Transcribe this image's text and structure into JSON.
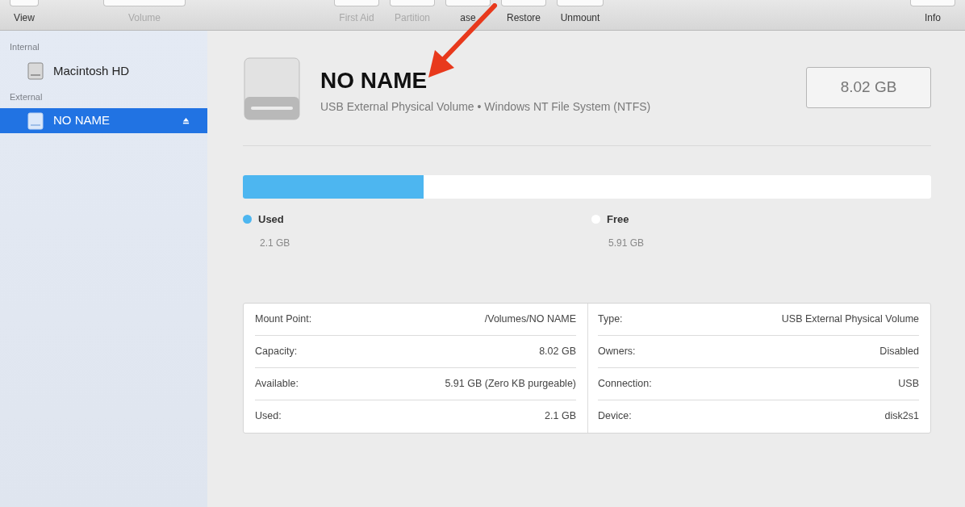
{
  "toolbar": {
    "left": [
      {
        "label": "View",
        "disabled": false
      },
      {
        "label": "Volume",
        "disabled": true
      }
    ],
    "center": [
      {
        "label": "First Aid",
        "disabled": true
      },
      {
        "label": "Partition",
        "disabled": true
      },
      {
        "label": "ase",
        "disabled": false
      },
      {
        "label": "Restore",
        "disabled": false
      },
      {
        "label": "Unmount",
        "disabled": false
      }
    ],
    "right": [
      {
        "label": "Info",
        "disabled": false
      }
    ]
  },
  "sidebar": {
    "sections": [
      {
        "title": "Internal",
        "items": [
          {
            "label": "Macintosh HD",
            "selected": false,
            "eject": false
          }
        ]
      },
      {
        "title": "External",
        "items": [
          {
            "label": "NO NAME",
            "selected": true,
            "eject": true
          }
        ]
      }
    ]
  },
  "volume": {
    "name": "NO NAME",
    "description": "USB External Physical Volume • Windows NT File System (NTFS)",
    "capacity": "8.02 GB"
  },
  "usage": {
    "level": 0.263,
    "legend": [
      {
        "label": "Used",
        "value": "2.1 GB",
        "color": "#4db6f0"
      },
      {
        "label": "Free",
        "value": "5.91 GB",
        "color": "#ffffff"
      }
    ]
  },
  "info": {
    "left": [
      {
        "label": "Mount Point:",
        "value": "/Volumes/NO NAME"
      },
      {
        "label": "Capacity:",
        "value": "8.02 GB"
      },
      {
        "label": "Available:",
        "value": "5.91 GB (Zero KB purgeable)"
      },
      {
        "label": "Used:",
        "value": "2.1 GB"
      }
    ],
    "right": [
      {
        "label": "Type:",
        "value": "USB External Physical Volume"
      },
      {
        "label": "Owners:",
        "value": "Disabled"
      },
      {
        "label": "Connection:",
        "value": "USB"
      },
      {
        "label": "Device:",
        "value": "disk2s1"
      }
    ]
  }
}
